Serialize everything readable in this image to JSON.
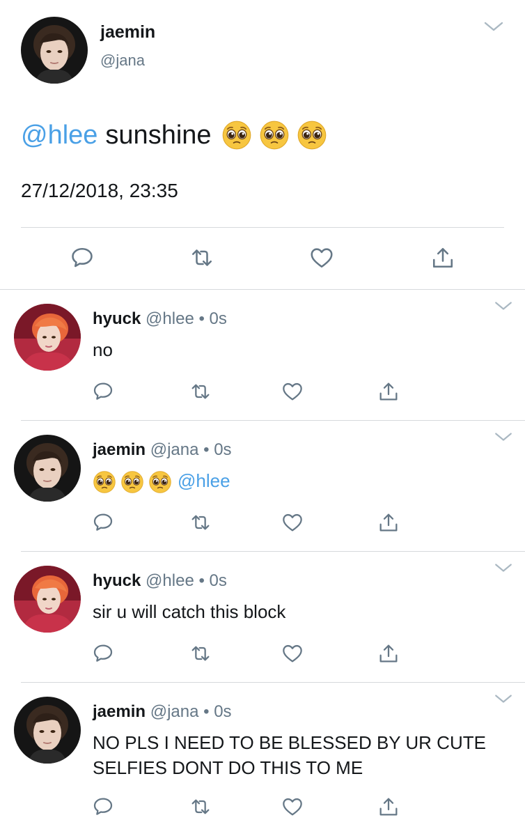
{
  "main_tweet": {
    "name": "jaemin",
    "handle": "@jana",
    "mention": "@hlee",
    "text": "sunshine",
    "emoji": "pleading-face",
    "datetime": "27/12/2018, 23:35"
  },
  "replies": [
    {
      "name": "hyuck",
      "handle": "@hlee",
      "dot": "•",
      "time": "0s",
      "text": "no",
      "avatar": "hyuck"
    },
    {
      "name": "jaemin",
      "handle": "@jana",
      "dot": "•",
      "time": "0s",
      "text": "",
      "mention": "@hlee",
      "avatar": "jaemin",
      "emoji": "pleading-face"
    },
    {
      "name": "hyuck",
      "handle": "@hlee",
      "dot": "•",
      "time": "0s",
      "text": "sir u will catch this block",
      "avatar": "hyuck"
    },
    {
      "name": "jaemin",
      "handle": "@jana",
      "dot": "•",
      "time": "0s",
      "text": "NO PLS I NEED TO BE BLESSED BY UR CUTE SELFIES DONT DO THIS TO ME",
      "avatar": "jaemin"
    }
  ],
  "actions": [
    "reply-icon",
    "retweet-icon",
    "like-icon",
    "share-icon"
  ],
  "colors": {
    "mention": "#4aa0e6",
    "icon": "#657786",
    "divider": "#d6d9dc",
    "text": "#14171a"
  }
}
